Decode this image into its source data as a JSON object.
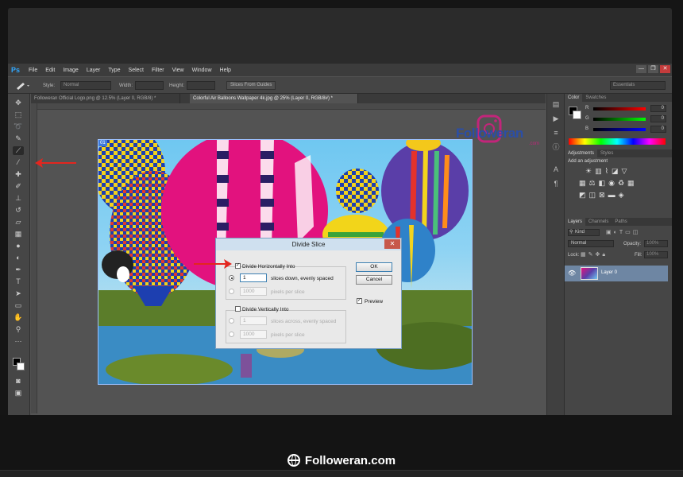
{
  "app": {
    "logo": "Ps",
    "menu": [
      "File",
      "Edit",
      "Image",
      "Layer",
      "Type",
      "Select",
      "Filter",
      "View",
      "Window",
      "Help"
    ],
    "window_buttons": [
      "—",
      "❐",
      "✕"
    ]
  },
  "options_bar": {
    "style_label": "Style:",
    "style_value": "Normal",
    "width_label": "Width:",
    "height_label": "Height:",
    "slices_button": "Slices From Guides",
    "workspace": "Essentials"
  },
  "documents": {
    "tabs": [
      "Followeran Official Logo.png @ 12.5% (Layer 0, RGB/8) *",
      "Colorful Air Balloons Wallpaper 4k.jpg @ 25% (Layer 0, RGB/8#) *"
    ]
  },
  "watermark": {
    "text": "Followeran",
    "sub": ".com"
  },
  "slice_badge": "01",
  "dialog": {
    "title": "Divide Slice",
    "divide_h_label": "Divide Horizontally Into",
    "divide_h_checked": true,
    "slices_down_value": "1",
    "slices_down_label": "slices down, evenly spaced",
    "pixels_h_value": "1000",
    "pixels_label": "pixels per slice",
    "divide_v_label": "Divide Vertically Into",
    "divide_v_checked": false,
    "slices_across_value": "1",
    "slices_across_label": "slices across, evenly spaced",
    "pixels_v_value": "1000",
    "ok": "OK",
    "cancel": "Cancel",
    "preview_label": "Preview",
    "preview_checked": true
  },
  "color_panel": {
    "tabs": [
      "Color",
      "Swatches"
    ],
    "channels": [
      "R",
      "G",
      "B"
    ],
    "values": [
      "0",
      "0",
      "0"
    ]
  },
  "adjustments_panel": {
    "tabs": [
      "Adjustments",
      "Styles"
    ],
    "header": "Add an adjustment"
  },
  "layers_panel": {
    "tabs": [
      "Layers",
      "Channels",
      "Paths"
    ],
    "kind": "Kind",
    "blend_mode": "Normal",
    "opacity_label": "Opacity:",
    "opacity_value": "100%",
    "lock_label": "Lock:",
    "fill_label": "Fill:",
    "fill_value": "100%",
    "layer_name": "Layer 0"
  },
  "site": {
    "brand": "Followeran.com"
  },
  "colors": {
    "accent": "#31a8ff",
    "annotation_red": "#e3261f",
    "dialog_title_bg": "#cfe0ef",
    "layer_selected": "#6e86a3"
  }
}
